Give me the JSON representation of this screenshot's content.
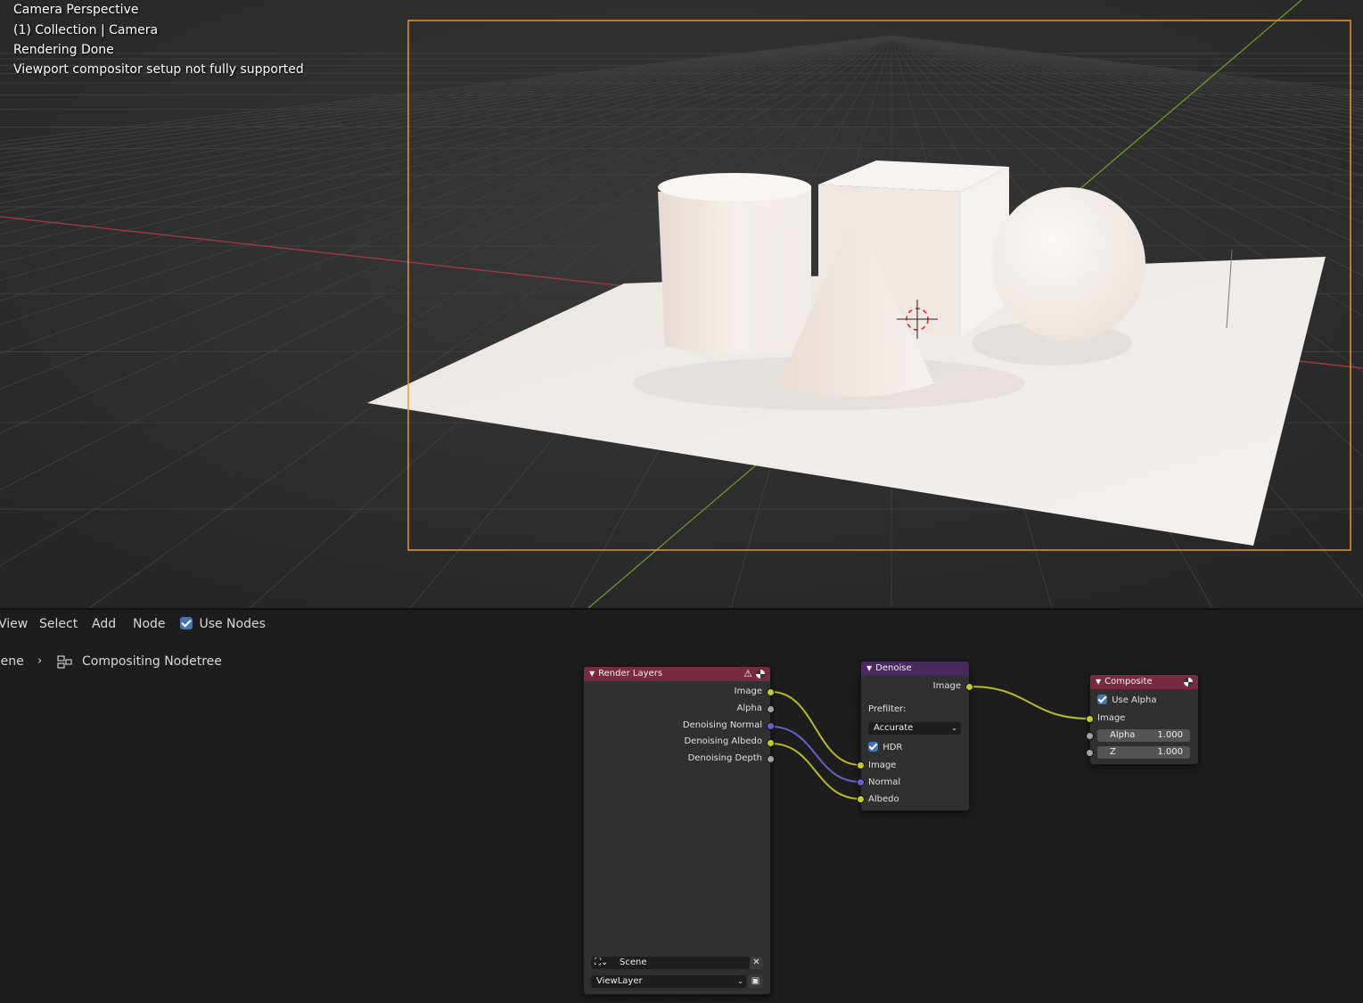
{
  "viewport": {
    "overlay": {
      "line1": "Camera Perspective",
      "line2": "(1) Collection | Camera",
      "line3": "Rendering Done",
      "line4": "Viewport compositor setup not fully supported"
    },
    "colors": {
      "camera_frame": "#e8962e",
      "x_axis": "#a83a44",
      "y_axis": "#6a9a2a",
      "grid": "#3a3a3a",
      "background": "#2f2f2f"
    },
    "scene_objects": [
      "plane",
      "cylinder",
      "cube",
      "cone",
      "sphere",
      "3d-cursor"
    ]
  },
  "node_editor": {
    "menu": {
      "view": "View",
      "select": "Select",
      "add": "Add",
      "node": "Node",
      "use_nodes": "Use Nodes"
    },
    "breadcrumb": {
      "scene": "Scene",
      "nodetree": "Compositing Nodetree"
    },
    "render_layers": {
      "title": "Render Layers",
      "header_color": "#7a2a40",
      "outputs": [
        "Image",
        "Alpha",
        "Denoising Normal",
        "Denoising Albedo",
        "Denoising Depth"
      ],
      "scene_field": "Scene",
      "layer_field": "ViewLayer"
    },
    "denoise": {
      "title": "Denoise",
      "header_color": "#4a2a5e",
      "output": "Image",
      "prefilter_label": "Prefilter:",
      "prefilter_value": "Accurate",
      "hdr_label": "HDR",
      "inputs": [
        "Image",
        "Normal",
        "Albedo"
      ]
    },
    "composite": {
      "title": "Composite",
      "header_color": "#7a2a40",
      "use_alpha_label": "Use Alpha",
      "image_label": "Image",
      "alpha_label": "Alpha",
      "alpha_value": "1.000",
      "z_label": "Z",
      "z_value": "1.000"
    },
    "socket_colors": {
      "color": "#c7c729",
      "vector": "#6363c7",
      "float": "#a1a1a1"
    }
  }
}
